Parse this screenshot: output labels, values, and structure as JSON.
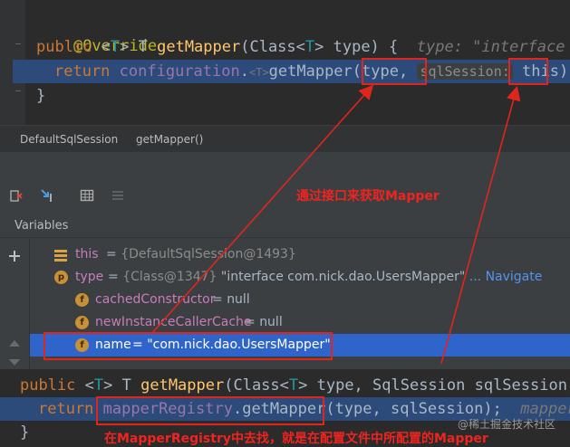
{
  "editor_top": {
    "line1": "@Override",
    "line2": {
      "public": "public ",
      "lt": "<",
      "tparam": "T",
      "gt": "> T ",
      "method": "getMapper",
      "open": "(Class<",
      "tparam2": "T",
      "close": "> type) {",
      "hint": "  type: \"interface c"
    },
    "line3": {
      "ret": "return ",
      "field": "configuration",
      "dot": ".",
      "typearg": "<T>",
      "method": "getMapper",
      "args": "(type, ",
      "inlay": "sqlSession:",
      "tail": " this);"
    },
    "line4": "}"
  },
  "breadcrumb": {
    "class_name": "DefaultSqlSession",
    "method_name": "getMapper()"
  },
  "debugger": {
    "panel_title": "Variables",
    "variables": [
      {
        "name": "this",
        "value": "{DefaultSqlSession@1493}",
        "expandable": true,
        "badge": ""
      },
      {
        "name": "type",
        "value": "{Class@1347}",
        "desc": "\"interface com.nick.dao.UsersMapper\"",
        "link": "... Navigate",
        "expandable": true,
        "badge": "p"
      },
      {
        "name": "cachedConstructor",
        "value": "null",
        "badge": "f"
      },
      {
        "name": "newInstanceCallerCache",
        "value": "null",
        "badge": "f"
      },
      {
        "name": "name",
        "value": "\"com.nick.dao.UsersMapper\"",
        "badge": "f",
        "selected": true
      }
    ]
  },
  "editor_bottom": {
    "line1": {
      "public": "public ",
      "lt": "<",
      "tparam": "T",
      "gt": "> T ",
      "method": "getMapper",
      "open": "(Class<",
      "tparam2": "T",
      "rest": "> type, SqlSession sqlSession)"
    },
    "line2": {
      "ret": "return ",
      "field": "mapperRegistry",
      "dot": ".",
      "method": "getMapper",
      "args": "(type, sqlSession);",
      "hint": "  mapperR"
    },
    "line3": "}"
  },
  "annotations": {
    "note_top": "通过接口来获取Mapper",
    "note_bottom": "在MapperRegistry中去找，就是在配置文件中所配置的Mapper"
  },
  "watermark": "@稀土掘金技术社区",
  "colors": {
    "annotation_red": "#e0251d",
    "selection_blue": "#2f65ca",
    "exec_line": "#2d4b7a"
  }
}
